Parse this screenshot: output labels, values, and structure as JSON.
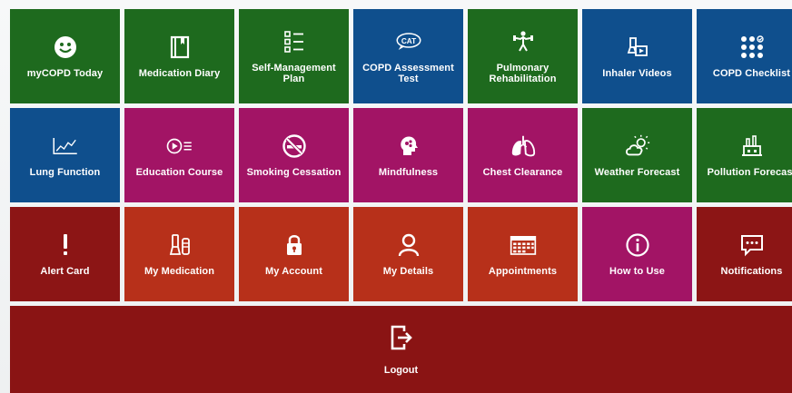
{
  "tiles": [
    {
      "label": "myCOPD Today",
      "icon": "smiley-icon",
      "color": "#1e6a1e"
    },
    {
      "label": "Medication Diary",
      "icon": "diary-book-icon",
      "color": "#1e6a1e"
    },
    {
      "label": "Self-Management Plan",
      "icon": "checklist-icon",
      "color": "#1e6a1e"
    },
    {
      "label": "COPD Assessment Test",
      "icon": "cat-speech-bubble-icon",
      "color": "#0f4f8d"
    },
    {
      "label": "Pulmonary Rehabilitation",
      "icon": "exercise-figure-icon",
      "color": "#1e6a1e"
    },
    {
      "label": "Inhaler Videos",
      "icon": "inhaler-video-icon",
      "color": "#0f4f8d"
    },
    {
      "label": "COPD Checklist",
      "icon": "dots-grid-icon",
      "color": "#0f4f8d"
    },
    {
      "label": "Lung Function",
      "icon": "line-graph-icon",
      "color": "#0f4f8d"
    },
    {
      "label": "Education Course",
      "icon": "play-list-icon",
      "color": "#a21465"
    },
    {
      "label": "Smoking Cessation",
      "icon": "no-smoking-icon",
      "color": "#a21465"
    },
    {
      "label": "Mindfulness",
      "icon": "head-brain-icon",
      "color": "#a21465"
    },
    {
      "label": "Chest Clearance",
      "icon": "lungs-icon",
      "color": "#a21465"
    },
    {
      "label": "Weather Forecast",
      "icon": "weather-cloud-sun-icon",
      "color": "#1e6a1e"
    },
    {
      "label": "Pollution Forecast",
      "icon": "factory-icon",
      "color": "#1e6a1e"
    },
    {
      "label": "Alert Card",
      "icon": "exclamation-icon",
      "color": "#8c1515"
    },
    {
      "label": "My Medication",
      "icon": "inhaler-icon",
      "color": "#b7301a"
    },
    {
      "label": "My Account",
      "icon": "padlock-icon",
      "color": "#b7301a"
    },
    {
      "label": "My Details",
      "icon": "user-icon",
      "color": "#b7301a"
    },
    {
      "label": "Appointments",
      "icon": "calendar-icon",
      "color": "#b7301a"
    },
    {
      "label": "How to Use",
      "icon": "info-icon",
      "color": "#a21465"
    },
    {
      "label": "Notifications",
      "icon": "message-bubble-icon",
      "color": "#8c1515"
    }
  ],
  "logout": {
    "label": "Logout",
    "icon": "logout-door-icon",
    "color": "#8a1414"
  }
}
